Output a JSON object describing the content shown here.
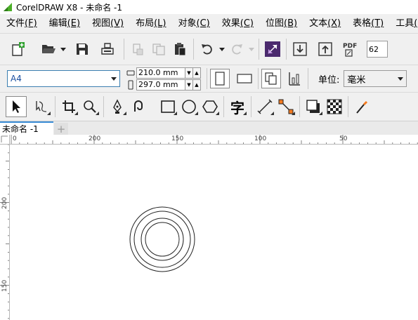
{
  "window": {
    "title": "CorelDRAW X8 - 未命名 -1"
  },
  "menu": [
    {
      "label": "文件",
      "key": "(F)"
    },
    {
      "label": "编辑",
      "key": "(E)"
    },
    {
      "label": "视图",
      "key": "(V)"
    },
    {
      "label": "布局",
      "key": "(L)"
    },
    {
      "label": "对象",
      "key": "(C)"
    },
    {
      "label": "效果",
      "key": "(C)"
    },
    {
      "label": "位图",
      "key": "(B)"
    },
    {
      "label": "文本",
      "key": "(X)"
    },
    {
      "label": "表格",
      "key": "(T)"
    },
    {
      "label": "工具",
      "key": "(O)"
    }
  ],
  "standard_toolbar": {
    "icons": [
      "new-document-icon",
      "open-folder-icon",
      "save-icon",
      "print-icon",
      "cut-icon",
      "copy-icon",
      "paste-icon",
      "undo-icon",
      "redo-icon",
      "search-content-icon",
      "import-icon",
      "export-icon",
      "publish-pdf-icon"
    ],
    "pdf_label": "PDF",
    "zoom_value": "62"
  },
  "property_bar": {
    "page_size": "A4",
    "width": "210.0 mm",
    "height": "297.0 mm",
    "unit_label": "单位:",
    "unit_value": "毫米"
  },
  "toolbox": {
    "text_tool_glyph": "字",
    "icons": [
      "pick-tool-icon",
      "shape-tool-icon",
      "crop-tool-icon",
      "zoom-tool-icon",
      "pen-tool-icon",
      "artistic-media-icon",
      "rectangle-tool-icon",
      "ellipse-tool-icon",
      "polygon-tool-icon",
      "text-tool-icon",
      "dimension-tool-icon",
      "connector-tool-icon",
      "drop-shadow-icon",
      "transparency-icon",
      "eyedropper-icon"
    ]
  },
  "tabs": {
    "active": "未命名 -1",
    "add": "+"
  },
  "ruler_h": {
    "labels": [
      "0",
      "200",
      "150",
      "100",
      "50"
    ]
  },
  "ruler_v": {
    "labels": [
      "200",
      "150"
    ]
  },
  "colors": {
    "accent": "#3a8dd6",
    "logo_green": "#4caf28",
    "purple": "#4b2a6e"
  }
}
